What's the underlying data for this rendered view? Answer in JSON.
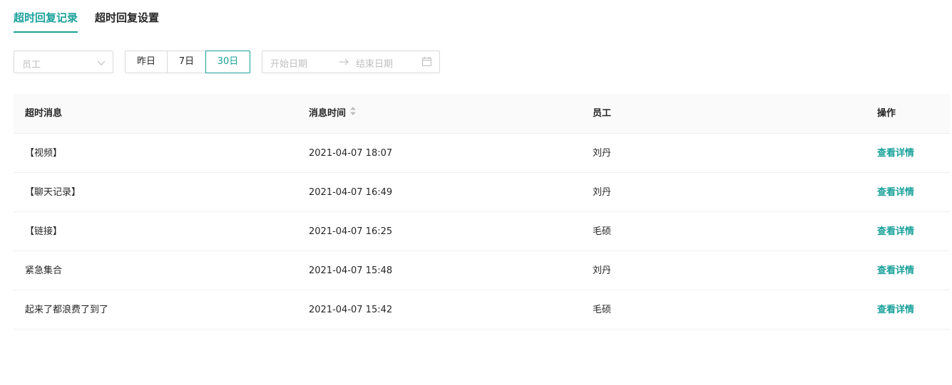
{
  "tabs": [
    {
      "label": "超时回复记录",
      "active": true
    },
    {
      "label": "超时回复设置",
      "active": false
    }
  ],
  "filters": {
    "employee_placeholder": "员工",
    "range_buttons": [
      "昨日",
      "7日",
      "30日"
    ],
    "range_selected": "30日",
    "start_placeholder": "开始日期",
    "end_placeholder": "结束日期",
    "icons": {
      "select": "chevron-down-icon",
      "arrow": "arrow-right-icon",
      "calendar": "calendar-icon"
    }
  },
  "table": {
    "columns": [
      "超时消息",
      "消息时间",
      "员工",
      "操作"
    ],
    "rows": [
      {
        "message": "【视频】",
        "time": "2021-04-07 18:07",
        "employee": "刘丹",
        "action": "查看详情"
      },
      {
        "message": "【聊天记录】",
        "time": "2021-04-07 16:49",
        "employee": "刘丹",
        "action": "查看详情"
      },
      {
        "message": "【链接】",
        "time": "2021-04-07 16:25",
        "employee": "毛硕",
        "action": "查看详情"
      },
      {
        "message": "紧急集合",
        "time": "2021-04-07 15:48",
        "employee": "刘丹",
        "action": "查看详情"
      },
      {
        "message": "起来了都浪费了到了",
        "time": "2021-04-07 15:42",
        "employee": "毛硕",
        "action": "查看详情"
      }
    ]
  },
  "colors": {
    "accent": "#1aa19a",
    "border": "#d9d9d9",
    "header_bg": "#fafafa"
  }
}
